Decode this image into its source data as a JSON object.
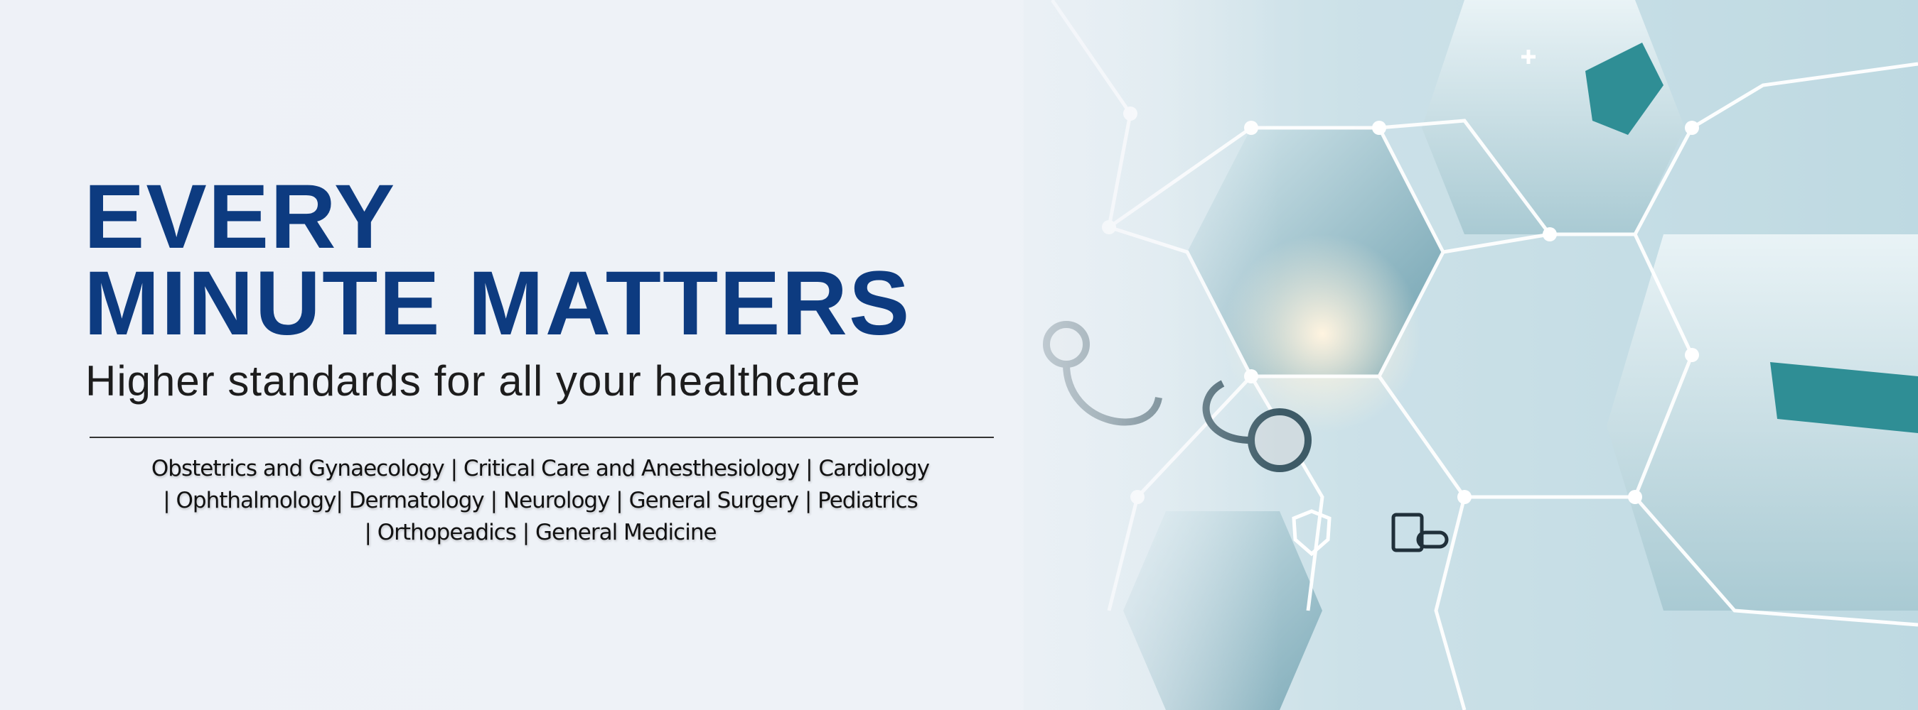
{
  "banner": {
    "headline_line1": "EVERY",
    "headline_line2": "MINUTE MATTERS",
    "subtitle": "Higher standards for all your healthcare",
    "specialties_lines": [
      "Obstetrics and Gynaecology | Critical Care and Anesthesiology | Cardiology",
      "| Ophthalmology| Dermatology | Neurology | General Surgery | Pediatrics",
      "| Orthopeadics | General Medicine"
    ]
  },
  "colors": {
    "headline": "#0d3b80",
    "accent": "#2fa5b5",
    "background": "#eef1f7"
  },
  "icons": [
    "stethoscope-icon",
    "medicine-icon",
    "shield-cross-icon",
    "document-icon",
    "plus-icon"
  ]
}
